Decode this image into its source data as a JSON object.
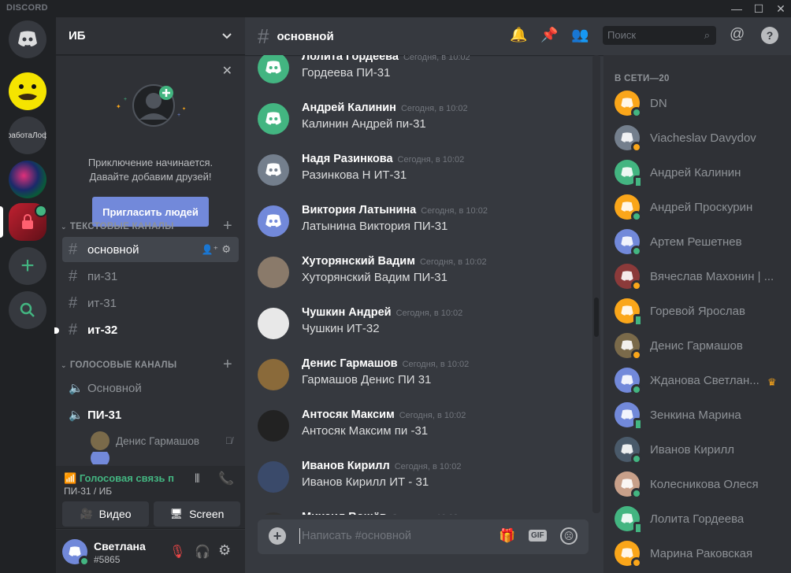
{
  "app": {
    "title": "DISCORD"
  },
  "window": {
    "minimize": "—",
    "maximize": "☐",
    "close": "✕"
  },
  "guilds": [
    {
      "kind": "home",
      "icon": "discord-logo-icon"
    },
    {
      "kind": "image",
      "name": "smiley-server"
    },
    {
      "kind": "text",
      "label": "работаЛоф"
    },
    {
      "kind": "image",
      "name": "abstract-server"
    },
    {
      "kind": "image",
      "name": "red-server"
    },
    {
      "kind": "action",
      "icon": "plus-icon"
    },
    {
      "kind": "action",
      "icon": "search-icon"
    }
  ],
  "server": {
    "name": "ИБ"
  },
  "invite": {
    "line1": "Приключение начинается.",
    "line2": "Давайте добавим друзей!",
    "button": "Пригласить людей"
  },
  "categories": {
    "text": "ТЕКСТОВЫЕ КАНАЛЫ",
    "voice": "ГОЛОСОВЫЕ КАНАЛЫ"
  },
  "text_channels": [
    "основной",
    "пи-31",
    "ит-31",
    "ит-32"
  ],
  "voice_channels": [
    "Основной",
    "ПИ-31"
  ],
  "voice_users": [
    "Денис Гармашов"
  ],
  "voice_status": {
    "state": "Голосовая связь подключена",
    "location": "ПИ-31 / ИБ",
    "video": "Видео",
    "screen": "Screen"
  },
  "user": {
    "name": "Светлана",
    "tag": "#5865"
  },
  "chat": {
    "channel": "основной",
    "placeholder": "Написать #основной",
    "gif": "GIF"
  },
  "search": {
    "placeholder": "Поиск"
  },
  "messages": [
    {
      "author": "Лолита Гордеева",
      "time": "Сегодня, в 10:02",
      "text": "Гордеева ПИ-31",
      "avatar": "green"
    },
    {
      "author": "Андрей Калинин",
      "time": "Сегодня, в 10:02",
      "text": "Калинин Андрей пи-31",
      "avatar": "green"
    },
    {
      "author": "Надя Разинкова",
      "time": "Сегодня, в 10:02",
      "text": "Разинкова Н ИТ-31",
      "avatar": "grey"
    },
    {
      "author": "Виктория Латынина",
      "time": "Сегодня, в 10:02",
      "text": "Латынина Виктория ПИ-31",
      "avatar": "blurple"
    },
    {
      "author": "Хуторянский Вадим",
      "time": "Сегодня, в 10:02",
      "text": "Хуторянский Вадим ПИ-31",
      "avatar": "photo"
    },
    {
      "author": "Чушкин Андрей",
      "time": "Сегодня, в 10:02",
      "text": "Чушкин ИТ-32",
      "avatar": "photo"
    },
    {
      "author": "Денис Гармашов",
      "time": "Сегодня, в 10:02",
      "text": "Гармашов Денис ПИ 31",
      "avatar": "photo"
    },
    {
      "author": "Антосяк Максим",
      "time": "Сегодня, в 10:02",
      "text": "Антосяк Максим пи -31",
      "avatar": "photo"
    },
    {
      "author": "Иванов Кирилл",
      "time": "Сегодня, в 10:02",
      "text": "Иванов Кирилл ИТ - 31",
      "avatar": "photo"
    },
    {
      "author": "Михаил Вощёв",
      "time": "Сегодня, в 10:02",
      "text": "",
      "avatar": "photo"
    }
  ],
  "members": {
    "header": "В СЕТИ—20",
    "list": [
      {
        "name": "DN",
        "av": "#faa61a",
        "status": "online"
      },
      {
        "name": "Viacheslav Davydov",
        "av": "#747f8d",
        "status": "idle"
      },
      {
        "name": "Андрей Калинин",
        "av": "#43b581",
        "status": "mobile"
      },
      {
        "name": "Андрей Проскурин",
        "av": "#faa61a",
        "status": "online"
      },
      {
        "name": "Артем Решетнев",
        "av": "#7289da",
        "status": "online"
      },
      {
        "name": "Вячеслав Махонин | ...",
        "av": "#8b3a3a",
        "status": "idle"
      },
      {
        "name": "Горевой Ярослав",
        "av": "#faa61a",
        "status": "mobile"
      },
      {
        "name": "Денис Гармашов",
        "av": "#7a6a4a",
        "status": "idle"
      },
      {
        "name": "Жданова Светлан...",
        "av": "#7289da",
        "status": "online"
      },
      {
        "name": "Зенкина Марина",
        "av": "#7289da",
        "status": "mobile"
      },
      {
        "name": "Иванов Кирилл",
        "av": "#4a5a6a",
        "status": "online"
      },
      {
        "name": "Колесникова Олеся",
        "av": "#c8a08a",
        "status": "online"
      },
      {
        "name": "Лолита Гордеева",
        "av": "#43b581",
        "status": "mobile"
      },
      {
        "name": "Марина Раковская",
        "av": "#faa61a",
        "status": "idle"
      }
    ]
  },
  "colors": {
    "online": "#43b581",
    "idle": "#faa61a",
    "mobile": "#43b581",
    "accent": "#7289da",
    "crown": "#faa61a"
  }
}
